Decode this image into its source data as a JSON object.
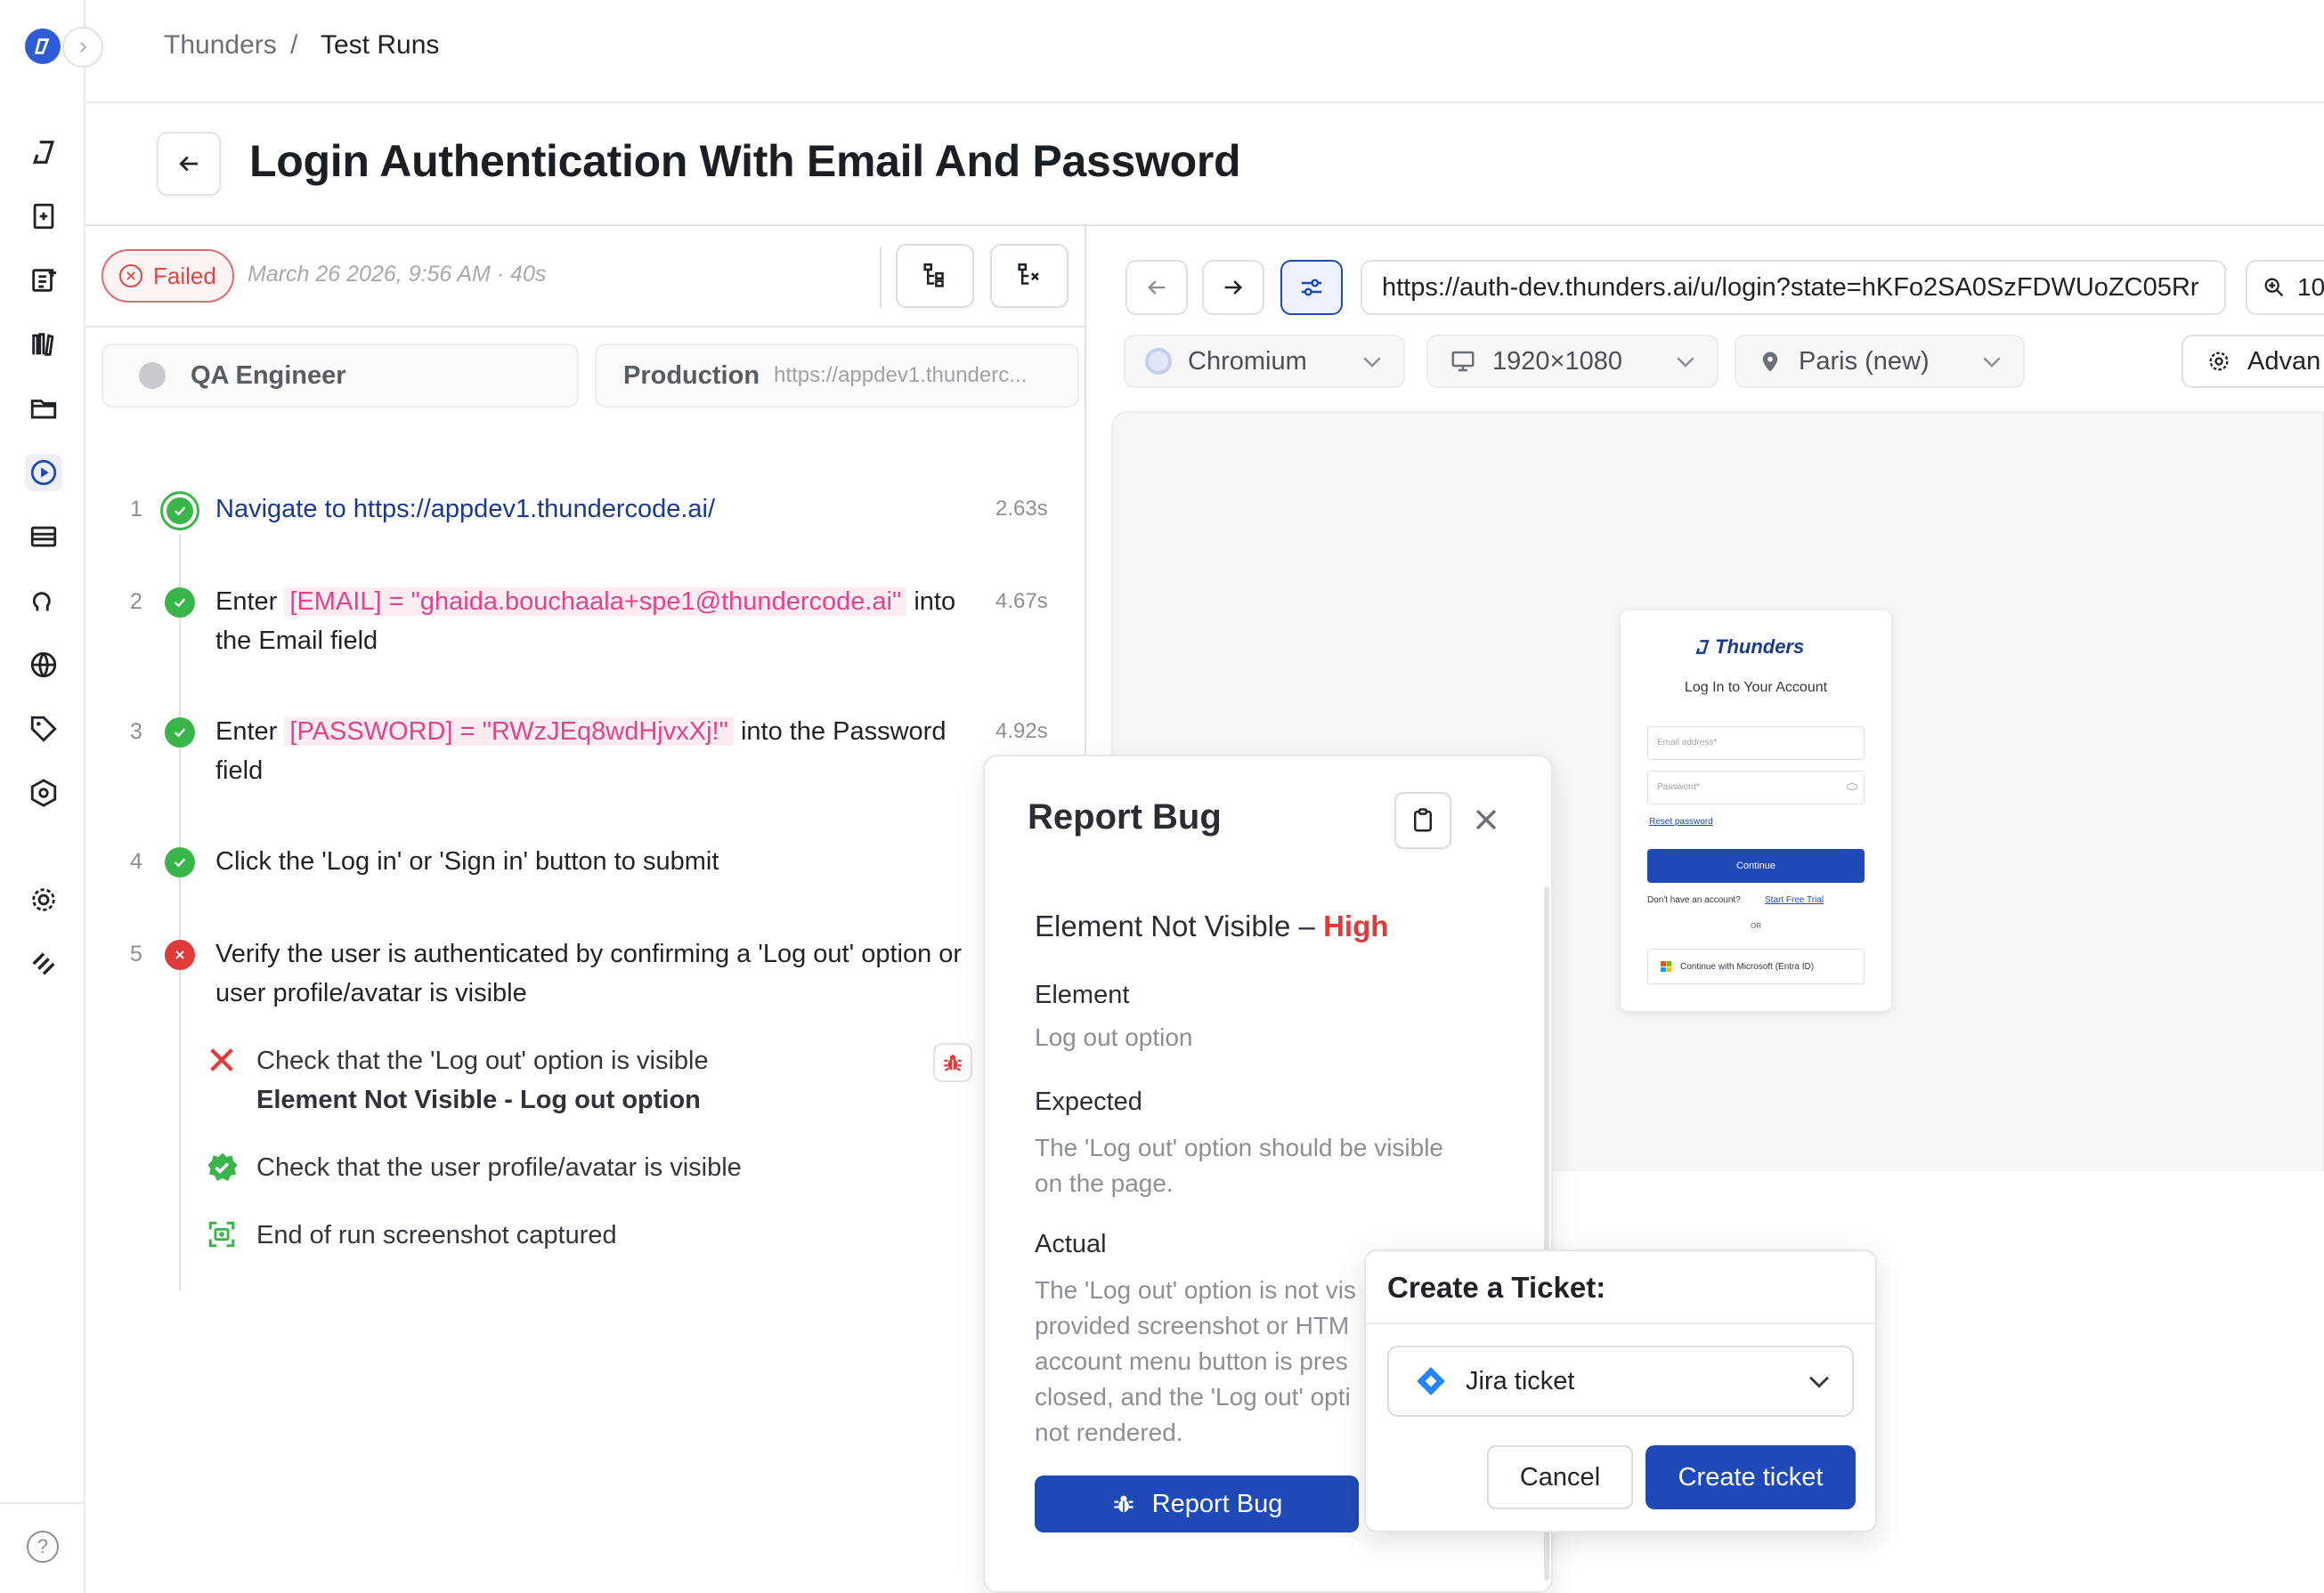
{
  "breadcrumb": {
    "project": "Thunders",
    "separator": "/",
    "current": "Test Runs"
  },
  "page": {
    "title": "Login Authentication With Email And Password"
  },
  "run": {
    "status": "Failed",
    "meta": "March 26 2026, 9:56 AM · 40s",
    "persona": "QA Engineer",
    "environment_name": "Production",
    "environment_url": "https://appdev1.thunderc..."
  },
  "steps": [
    {
      "num": "1",
      "text": "Navigate to https://appdev1.thundercode.ai/",
      "time": "2.63s"
    },
    {
      "num": "2",
      "prefix": "Enter",
      "var": "[EMAIL] = \"ghaida.bouchaala+spe1@thundercode.ai\"",
      "suffix_a": "into",
      "suffix_b": "the Email field",
      "time": "4.67s"
    },
    {
      "num": "3",
      "prefix": "Enter",
      "var": "[PASSWORD] = \"RWzJEq8wdHjvxXj!\"",
      "suffix_a": "into the Password",
      "suffix_b": "field",
      "time": "4.92s"
    },
    {
      "num": "4",
      "text": "Click the 'Log in' or 'Sign in' button to submit"
    },
    {
      "num": "5",
      "line1": "Verify the user is authenticated by confirming a 'Log out' option or",
      "line2": "user profile/avatar is visible"
    }
  ],
  "substeps": {
    "fail_text": "Check that the 'Log out' option is visible",
    "fail_detail": "Element Not Visible - Log out option",
    "pass_text": "Check that the user profile/avatar is visible",
    "screenshot_text": "End of run screenshot captured"
  },
  "browser": {
    "url": "https://auth-dev.thunders.ai/u/login?state=hKFo2SA0SzFDWUoZC05Rr",
    "zoom": "10",
    "engine": "Chromium",
    "resolution": "1920×1080",
    "location": "Paris (new)",
    "advanced": "Advan"
  },
  "login_preview": {
    "brand": "Thunders",
    "heading": "Log In to Your Account",
    "email_placeholder": "Email address*",
    "password_placeholder": "Password*",
    "reset": "Reset password",
    "continue": "Continue",
    "no_account": "Don't have an account?",
    "trial": "Start Free Trial",
    "or": "OR",
    "microsoft": "Continue with Microsoft (Entra ID)"
  },
  "report_bug": {
    "title": "Report Bug",
    "issue": "Element Not Visible –",
    "severity": "High",
    "element_label": "Element",
    "element_value": "Log out option",
    "expected_label": "Expected",
    "expected_l1": "The 'Log out' option should be visible",
    "expected_l2": "on the page.",
    "actual_label": "Actual",
    "actual_l1": "The 'Log out' option is not vis",
    "actual_l2": "provided screenshot or HTM",
    "actual_l3": "account menu button is pres",
    "actual_l4": "closed, and the 'Log out' opti",
    "actual_l5": "not rendered.",
    "button": "Report Bug"
  },
  "ticket": {
    "title": "Create a Ticket:",
    "selected": "Jira ticket",
    "cancel": "Cancel",
    "create": "Create ticket"
  },
  "colors": {
    "primary": "#1f49b6",
    "danger": "#e03a3a",
    "success": "#39b54a",
    "variable": "#e0448a"
  }
}
